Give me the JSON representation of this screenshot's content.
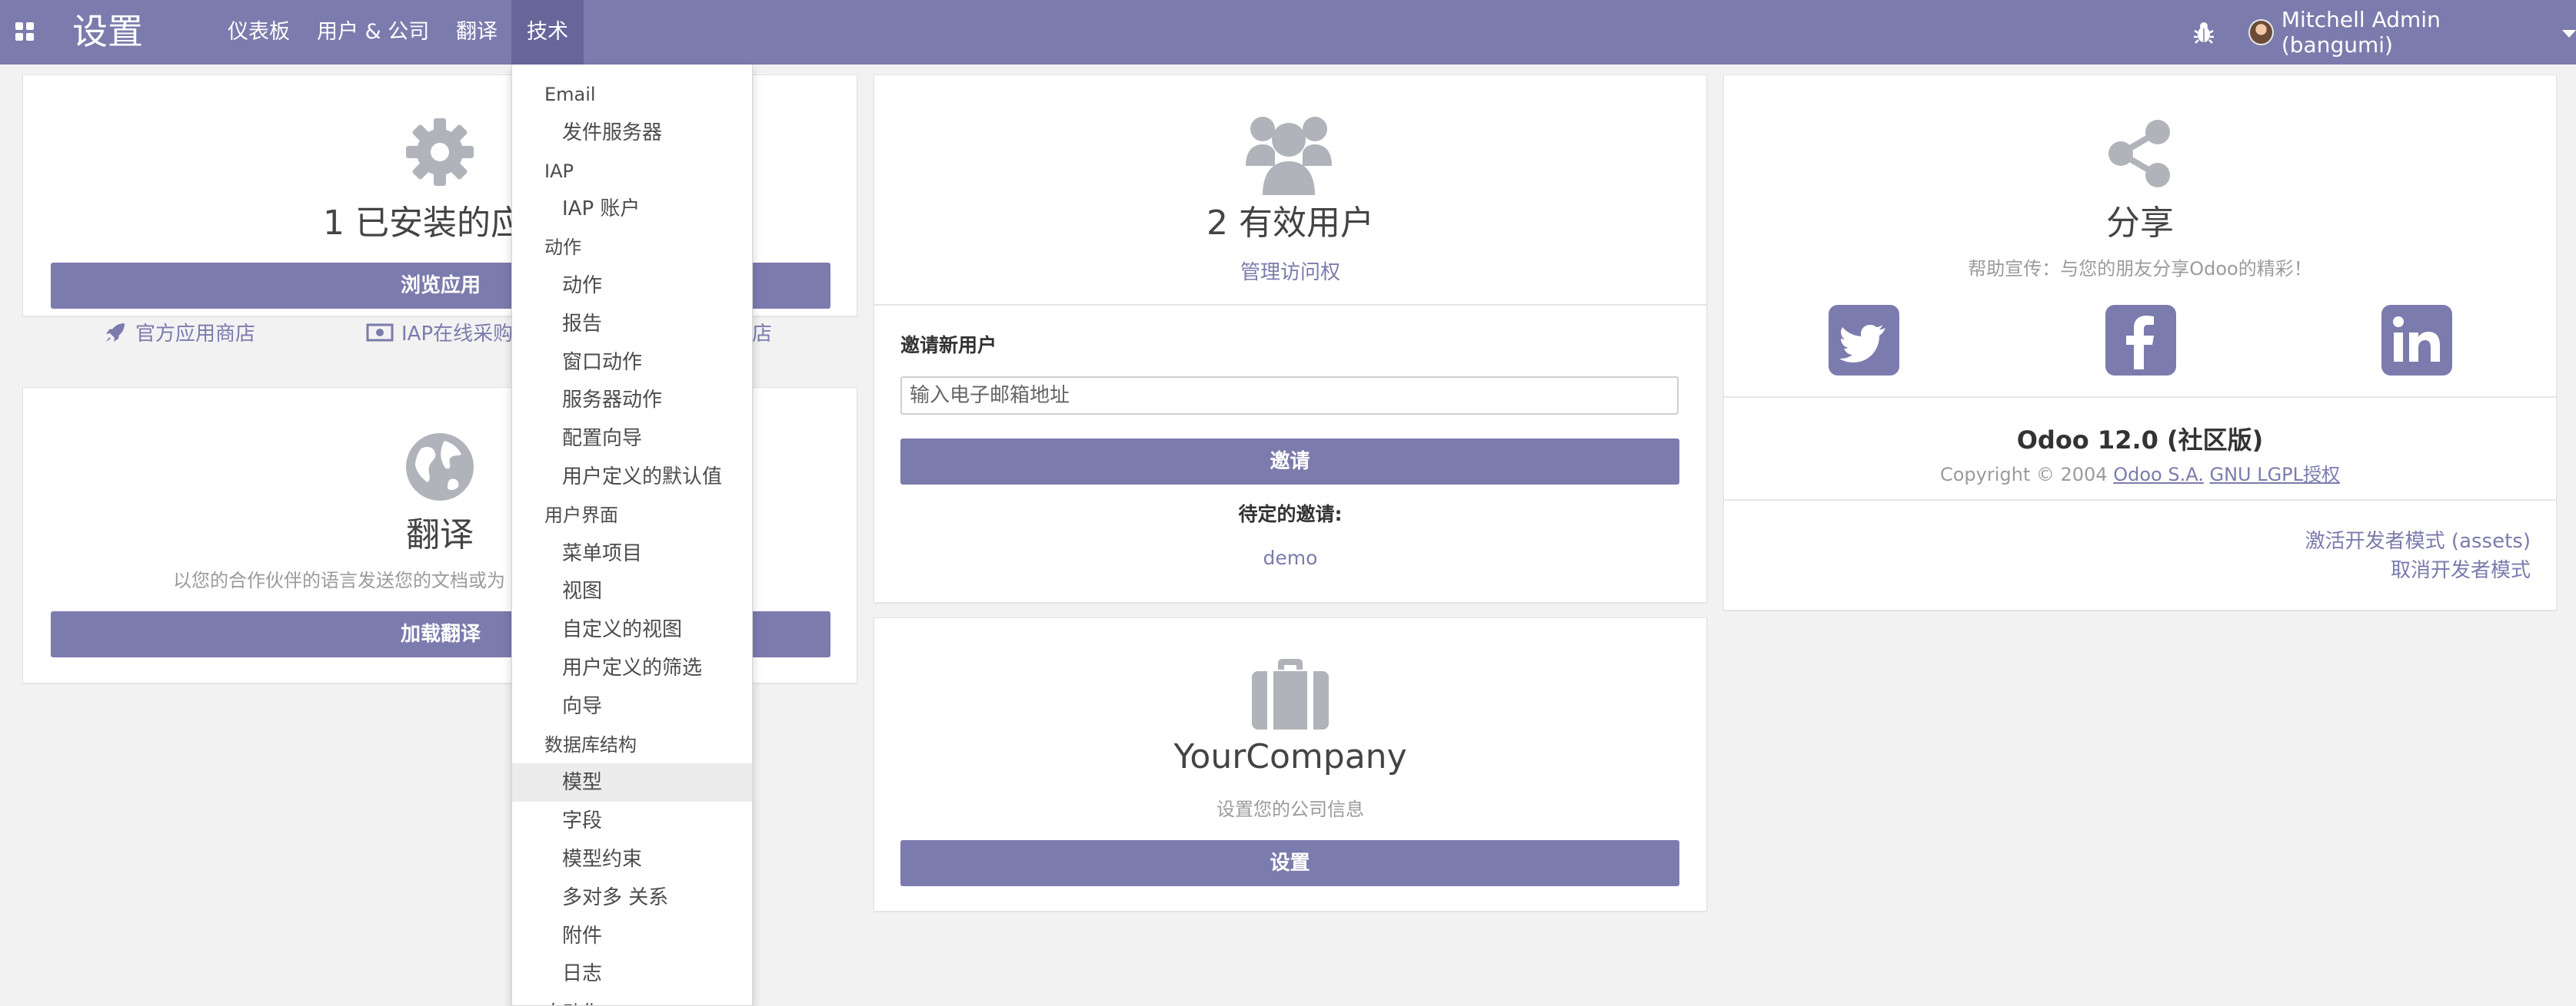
{
  "navbar": {
    "brand": "设置",
    "menu": [
      "仪表板",
      "用户 & 公司",
      "翻译",
      "技术"
    ],
    "user_name": "Mitchell Admin (bangumi)",
    "accent": "#7c7bad"
  },
  "apps_card": {
    "title": "1 已安装的应",
    "browse_button": "浏览应用",
    "store_link": "官方应用商店",
    "iap_link": "IAP在线采购",
    "iap_link_tail": "店"
  },
  "translate_card": {
    "title": "翻译",
    "description": "以您的合作伙伴的语言发送您的文档或为",
    "load_button": "加载翻译"
  },
  "users_card": {
    "title": "2 有效用户",
    "manage_link": "管理访问权",
    "invite_label": "邀请新用户",
    "email_placeholder": "输入电子邮箱地址",
    "invite_button": "邀请",
    "pending_label": "待定的邀请:",
    "pending_user": "demo"
  },
  "company_card": {
    "title": "YourCompany",
    "subtitle": "设置您的公司信息",
    "setup_button": "设置"
  },
  "share_card": {
    "title": "分享",
    "subtitle": "帮助宣传：与您的朋友分享Odoo的精彩！",
    "version": "Odoo 12.0 (社区版)",
    "copyright": "Copyright © 2004",
    "odoo_link": "Odoo S.A.",
    "license_link": "GNU LGPL授权",
    "dev_mode_assets": "激活开发者模式 (assets)",
    "dev_mode_off": "取消开发者模式"
  },
  "dropdown": {
    "items": [
      {
        "type": "header",
        "label": "Email"
      },
      {
        "type": "item",
        "label": "发件服务器"
      },
      {
        "type": "header",
        "label": "IAP"
      },
      {
        "type": "item",
        "label": "IAP 账户"
      },
      {
        "type": "header",
        "label": "动作"
      },
      {
        "type": "item",
        "label": "动作"
      },
      {
        "type": "item",
        "label": "报告"
      },
      {
        "type": "item",
        "label": "窗口动作"
      },
      {
        "type": "item",
        "label": "服务器动作"
      },
      {
        "type": "item",
        "label": "配置向导"
      },
      {
        "type": "item",
        "label": "用户定义的默认值"
      },
      {
        "type": "header",
        "label": "用户界面"
      },
      {
        "type": "item",
        "label": "菜单项目"
      },
      {
        "type": "item",
        "label": "视图"
      },
      {
        "type": "item",
        "label": "自定义的视图"
      },
      {
        "type": "item",
        "label": "用户定义的筛选"
      },
      {
        "type": "item",
        "label": "向导"
      },
      {
        "type": "header",
        "label": "数据库结构"
      },
      {
        "type": "item",
        "label": "模型",
        "hover": true
      },
      {
        "type": "item",
        "label": "字段"
      },
      {
        "type": "item",
        "label": "模型约束"
      },
      {
        "type": "item",
        "label": "多对多 关系"
      },
      {
        "type": "item",
        "label": "附件"
      },
      {
        "type": "item",
        "label": "日志"
      },
      {
        "type": "header",
        "label": "自动化"
      }
    ]
  }
}
